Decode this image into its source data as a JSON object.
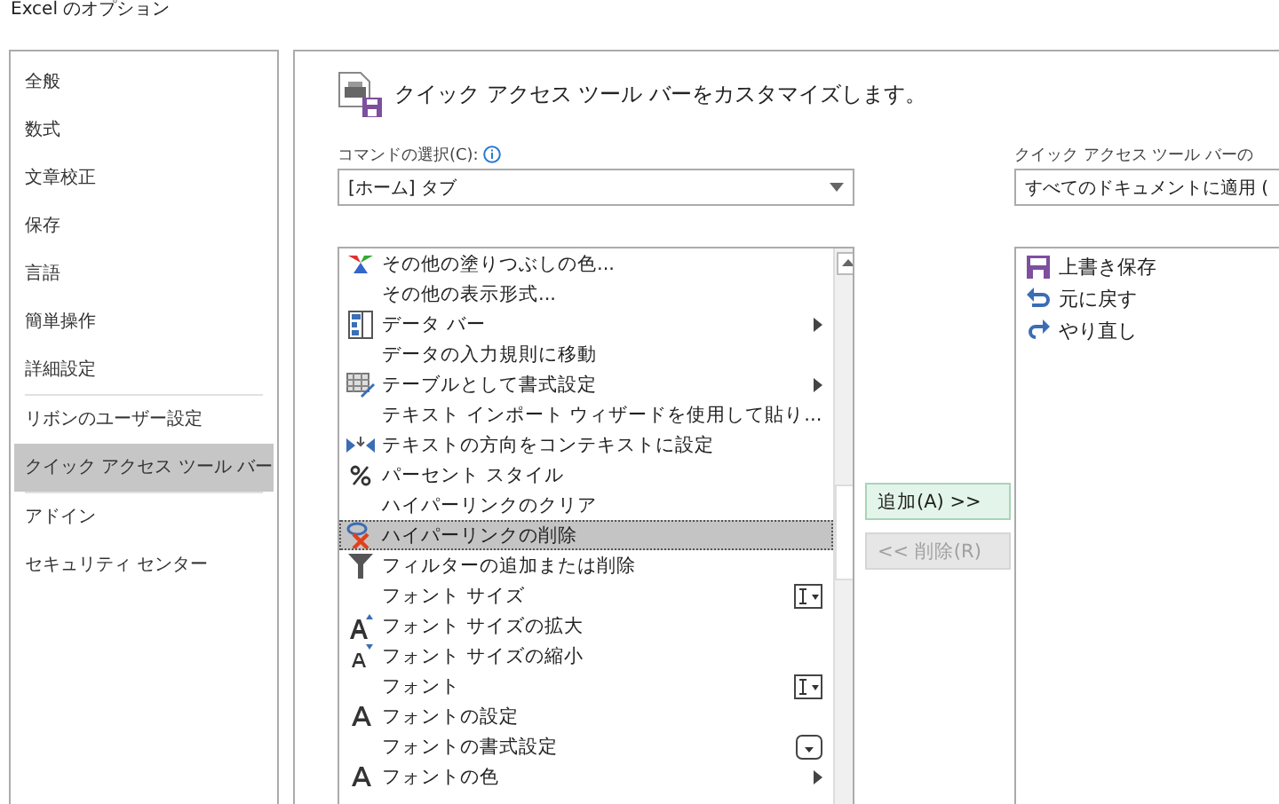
{
  "window": {
    "title": "Excel のオプション"
  },
  "sidebar": {
    "items": [
      {
        "label": "全般",
        "selected": false
      },
      {
        "label": "数式",
        "selected": false
      },
      {
        "label": "文章校正",
        "selected": false
      },
      {
        "label": "保存",
        "selected": false
      },
      {
        "label": "言語",
        "selected": false
      },
      {
        "label": "簡単操作",
        "selected": false
      },
      {
        "label": "詳細設定",
        "selected": false
      },
      {
        "label": "リボンのユーザー設定",
        "selected": false
      },
      {
        "label": "クイック アクセス ツール バー",
        "selected": true
      },
      {
        "label": "アドイン",
        "selected": false
      },
      {
        "label": "セキュリティ センター",
        "selected": false
      }
    ]
  },
  "header": {
    "text": "クイック アクセス ツール バーをカスタマイズします。"
  },
  "command_source": {
    "label": "コマンドの選択(C):",
    "value": "[ホーム] タブ"
  },
  "commands": [
    {
      "label": "その他の塗りつぶしの色...",
      "kind": "palette",
      "selected": false
    },
    {
      "label": "その他の表示形式...",
      "kind": "plain",
      "selected": false
    },
    {
      "label": "データ バー",
      "kind": "databar",
      "selected": false
    },
    {
      "label": "データの入力規則に移動",
      "kind": "plain",
      "selected": false
    },
    {
      "label": "テーブルとして書式設定",
      "kind": "table",
      "selected": false
    },
    {
      "label": "テキスト インポート ウィザードを使用して貼り...",
      "kind": "plain",
      "selected": false
    },
    {
      "label": "テキストの方向をコンテキストに設定",
      "kind": "direction",
      "selected": false
    },
    {
      "label": "パーセント スタイル",
      "kind": "percent",
      "selected": false
    },
    {
      "label": "ハイパーリンクのクリア",
      "kind": "plain",
      "selected": false
    },
    {
      "label": "ハイパーリンクの削除",
      "kind": "unlink",
      "selected": true
    },
    {
      "label": "フィルターの追加または削除",
      "kind": "filter",
      "selected": false
    },
    {
      "label": "フォント サイズ",
      "kind": "plain",
      "selected": false
    },
    {
      "label": "フォント サイズの拡大",
      "kind": "grow",
      "selected": false
    },
    {
      "label": "フォント サイズの縮小",
      "kind": "shrink",
      "selected": false
    },
    {
      "label": "フォント",
      "kind": "plain",
      "selected": false
    },
    {
      "label": "フォントの設定",
      "kind": "font",
      "selected": false
    },
    {
      "label": "フォントの書式設定",
      "kind": "plain",
      "selected": false
    },
    {
      "label": "フォントの色",
      "kind": "font",
      "selected": false
    }
  ],
  "buttons": [
    {
      "label": "追加(A) >>",
      "disabled": false
    },
    {
      "label": "<< 削除(R)",
      "disabled": true
    }
  ],
  "toolbar_target": {
    "label": "クイック アクセス ツール バーの",
    "value": "すべてのドキュメントに適用 ("
  },
  "toolbar_items": [
    {
      "label": "上書き保存",
      "kind": "save"
    },
    {
      "label": "元に戻す",
      "kind": "undo"
    },
    {
      "label": "やり直し",
      "kind": "redo"
    }
  ]
}
